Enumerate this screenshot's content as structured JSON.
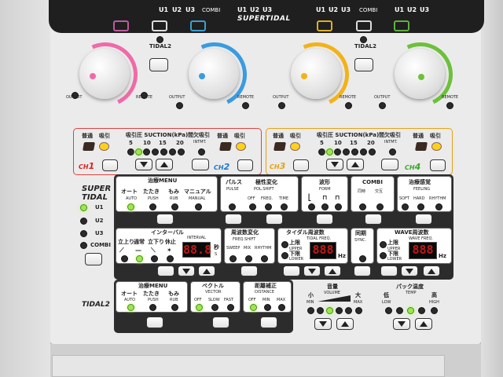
{
  "device": {
    "brand_label": "SUPERTIDAL"
  },
  "top_bar": {
    "left_group": {
      "u1": "U1",
      "u2": "U2",
      "u3": "U3",
      "combi": "COMBI"
    },
    "right_group": {
      "u1": "U1",
      "u2": "U2",
      "u3": "U3",
      "combi": "COMBI"
    }
  },
  "tidal2_label": "TIDAL2",
  "knobs": [
    {
      "output": "OUTPUT",
      "remote": "REMOTE",
      "color": "#f06aa8"
    },
    {
      "output": "OUTPUT",
      "remote": "REMOTE",
      "color": "#3a9be0"
    },
    {
      "output": "OUTPUT",
      "remote": "REMOTE",
      "color": "#f3b21a"
    },
    {
      "output": "OUTPUT",
      "remote": "REMOTE",
      "color": "#6cc13a"
    }
  ],
  "channel_panels": [
    {
      "normal": "普通",
      "suction": "吸引",
      "pressure_title": "吸引圧 SUCTION(kPa)",
      "p5": "5",
      "p10": "10",
      "p15": "15",
      "p20": "20",
      "intermit_jp": "間欠吸引",
      "intermit_en": "INTMT.",
      "ch_prefix": "CH",
      "ch_num": "1",
      "ch_color": "#e02020"
    },
    {
      "ch_prefix": "CH",
      "ch_num": "2",
      "ch_color": "#1a78d0"
    },
    {
      "normal": "普通",
      "suction": "吸引",
      "pressure_title": "吸引圧 SUCTION(kPa)",
      "p5": "5",
      "p10": "10",
      "p15": "15",
      "p20": "20",
      "intermit_jp": "間欠吸引",
      "intermit_en": "INTMT.",
      "ch_prefix": "CH",
      "ch_num": "3",
      "ch_color": "#e8a010"
    },
    {
      "normal": "普通",
      "suction": "吸引",
      "ch_prefix": "CH",
      "ch_num": "4",
      "ch_color": "#3aa82a"
    }
  ],
  "super_tidal": {
    "title1": "SUPER",
    "title2": "TIDAL",
    "modes": [
      "U1",
      "U2",
      "U3",
      "COMBI"
    ],
    "active_mode": "U1"
  },
  "treatment_menu": {
    "title": "治療MENU",
    "auto_jp": "オート",
    "auto_en": "AUTO",
    "push_jp": "たたき",
    "push_en": "PUSH",
    "rub_jp": "もみ",
    "rub_en": "RUB",
    "manual_jp": "マニュアル",
    "manual_en": "MANUAL"
  },
  "pulse": {
    "jp": "パルス",
    "en": "PULSE"
  },
  "polarity": {
    "jp": "極性変化",
    "en": "POL.SHIFT",
    "off": "OFF",
    "freq": "FREQ.",
    "time": "TIME"
  },
  "form": {
    "jp": "波形",
    "en": "FORM"
  },
  "combi": {
    "title": "COMBI",
    "same_jp": "同時",
    "alt_jp": "交互"
  },
  "feeling": {
    "jp": "治療感覚",
    "en": "FEELING",
    "soft": "SOFT",
    "hard": "HARD",
    "rhythm": "RHYTHM"
  },
  "interval": {
    "jp": "インターバル",
    "en": "INTERVAL",
    "rise": "立上り",
    "normal": "通常",
    "fall": "立下り",
    "rest": "休止",
    "display": "88.8",
    "unit_jp": "秒",
    "unit_en": "S"
  },
  "freq_shift": {
    "jp": "周波数変化",
    "en": "FREQ.SHIFT",
    "sweep": "SWEEP",
    "mix": "MIX",
    "rhythm": "RHYTHM"
  },
  "tidal_freq": {
    "jp": "タイダル周波数",
    "en": "TIDAL FREQ.",
    "upper_jp": "上限",
    "upper_en": "UPPER",
    "lower_jp": "下限",
    "lower_en": "LOWER",
    "display": "888",
    "unit": "Hz"
  },
  "sync": {
    "jp": "同期",
    "en": "SYNC."
  },
  "wave_freq": {
    "jp": "WAVE周波数",
    "en": "WAVE FREQ.",
    "upper_jp": "上限",
    "upper_en": "UPPER",
    "lower_jp": "下限",
    "lower_en": "LOWER",
    "display": "888",
    "unit": "Hz"
  },
  "tidal2": {
    "label": "TIDAL2",
    "menu": {
      "title": "治療MENU",
      "auto_jp": "オート",
      "auto_en": "AUTO",
      "push_jp": "たたき",
      "push_en": "PUSH",
      "rub_jp": "もみ",
      "rub_en": "RUB"
    },
    "vector": {
      "jp": "ベクトル",
      "en": "VECTOR",
      "off": "OFF",
      "slow": "SLOW",
      "fast": "FAST"
    },
    "distance": {
      "jp": "距離補正",
      "en": "DISTANCE",
      "off": "OFF",
      "min": "MIN",
      "max": "MAX"
    }
  },
  "volume": {
    "jp": "音量",
    "en": "VOLUME",
    "min_jp": "小",
    "min_en": "MIN",
    "max_jp": "大",
    "max_en": "MAX"
  },
  "pack_temp": {
    "jp": "パック温度",
    "en": "TEMP",
    "low_jp": "低",
    "low_en": "LOW",
    "high_jp": "高",
    "high_en": "HIGH"
  }
}
